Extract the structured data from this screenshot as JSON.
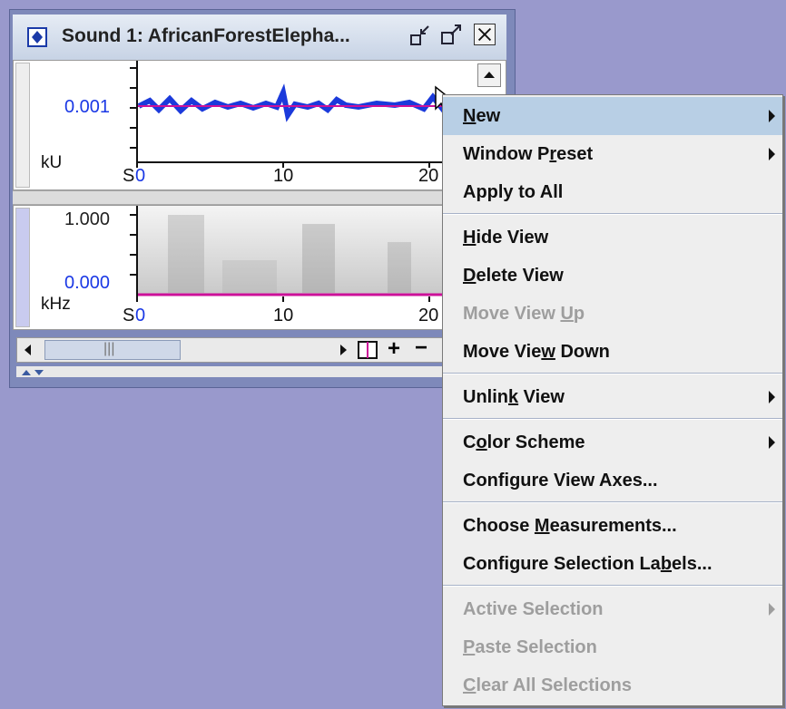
{
  "window": {
    "title": "Sound 1: AfricanForestElepha..."
  },
  "waveform_view": {
    "y_value": "0.001",
    "unit": "kU",
    "x_ticks": [
      "0",
      "10",
      "20"
    ],
    "x_unit": "S"
  },
  "spectrogram_view": {
    "y_top": "1.000",
    "y_bottom": "0.000",
    "unit": "kHz",
    "x_ticks": [
      "0",
      "10",
      "20"
    ],
    "x_unit": "S"
  },
  "toolbar": {
    "zoom_in": "+",
    "zoom_out": "−",
    "scroll_grip": "|||"
  },
  "menu": {
    "new": "New",
    "window_preset": "Window Preset",
    "apply_to_all": "Apply to All",
    "hide_view": "Hide View",
    "delete_view": "Delete View",
    "move_view_up": "Move View Up",
    "move_view_down": "Move View Down",
    "unlink_view": "Unlink View",
    "color_scheme": "Color Scheme",
    "configure_view_axes": "Configure View Axes...",
    "choose_measurements": "Choose Measurements...",
    "configure_selection_labels": "Configure Selection Labels...",
    "active_selection": "Active Selection",
    "paste_selection": "Paste Selection",
    "clear_all_selections": "Clear All Selections"
  },
  "colors": {
    "desktop": "#9999cc",
    "axis_blue": "#1a38e5",
    "baseline_magenta": "#cc1199",
    "menu_hover": "#b8cfe5"
  }
}
